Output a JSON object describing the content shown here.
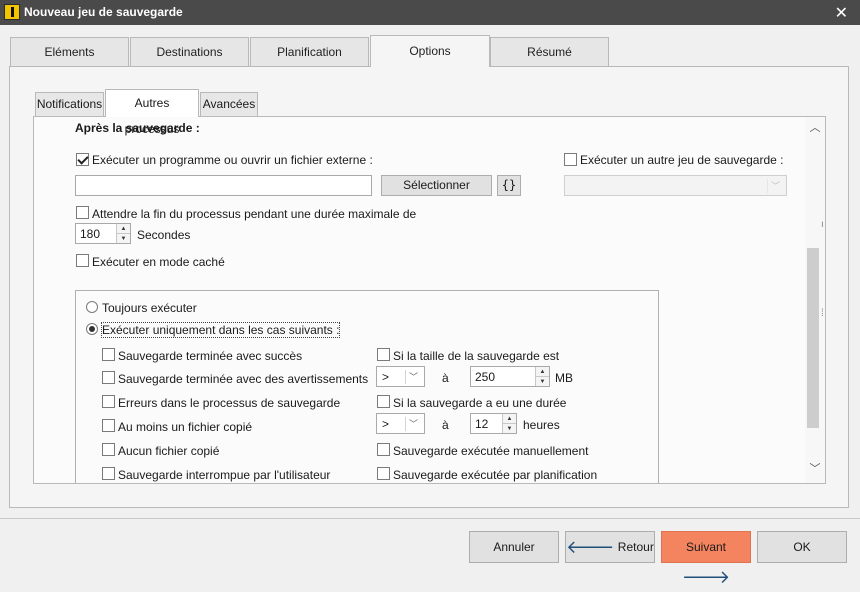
{
  "window": {
    "title": "Nouveau jeu de sauvegarde",
    "close_icon": "close-icon"
  },
  "main_tabs": [
    {
      "label": "Eléments"
    },
    {
      "label": "Destinations"
    },
    {
      "label": "Planification"
    },
    {
      "label": "Options"
    },
    {
      "label": "Résumé"
    }
  ],
  "sub_tabs": [
    {
      "label": "Notifications"
    },
    {
      "label": "Autres processus"
    },
    {
      "label": "Avancées"
    }
  ],
  "section": {
    "title": "Après la sauvegarde :",
    "run_program": {
      "label": "Exécuter un programme ou ouvrir un fichier externe :",
      "checked": true
    },
    "program_path": {
      "value": ""
    },
    "select_button": "Sélectionner",
    "variables_button": "{}",
    "run_other_set": {
      "label": "Exécuter un autre jeu de sauvegarde :",
      "checked": false
    },
    "other_set_dropdown": {
      "value": ""
    },
    "wait_end": {
      "label": "Attendre la fin du processus pendant une durée maximale de",
      "checked": false
    },
    "wait_seconds": {
      "value": "180",
      "unit": "Secondes"
    },
    "hidden_mode": {
      "label": "Exécuter en mode caché",
      "checked": false
    }
  },
  "conditions": {
    "always": {
      "label": "Toujours exécuter",
      "selected": false
    },
    "only_when": {
      "label": "Exécuter uniquement dans les cas suivants :",
      "selected": true
    },
    "left": [
      {
        "label": "Sauvegarde terminée avec succès"
      },
      {
        "label": "Sauvegarde terminée avec des avertissements"
      },
      {
        "label": "Erreurs dans le processus de sauvegarde"
      },
      {
        "label": "Au moins un fichier copié"
      },
      {
        "label": "Aucun fichier copié"
      },
      {
        "label": "Sauvegarde interrompue par l'utilisateur"
      }
    ],
    "size": {
      "label": "Si la taille de la sauvegarde est",
      "operator": ">",
      "a_label": "à",
      "value": "250",
      "unit": "MB"
    },
    "duration": {
      "label": "Si la sauvegarde a eu une durée",
      "operator": ">",
      "a_label": "à",
      "value": "12",
      "unit": "heures"
    },
    "manual": {
      "label": "Sauvegarde exécutée manuellement"
    },
    "scheduled": {
      "label": "Sauvegarde exécutée par planification"
    }
  },
  "footer": {
    "cancel": "Annuler",
    "back": "Retour",
    "next": "Suivant",
    "ok": "OK"
  },
  "colors": {
    "titlebar": "#4a4a4a",
    "primary_button": "#f4845f",
    "arrow": "#1f4e79"
  }
}
